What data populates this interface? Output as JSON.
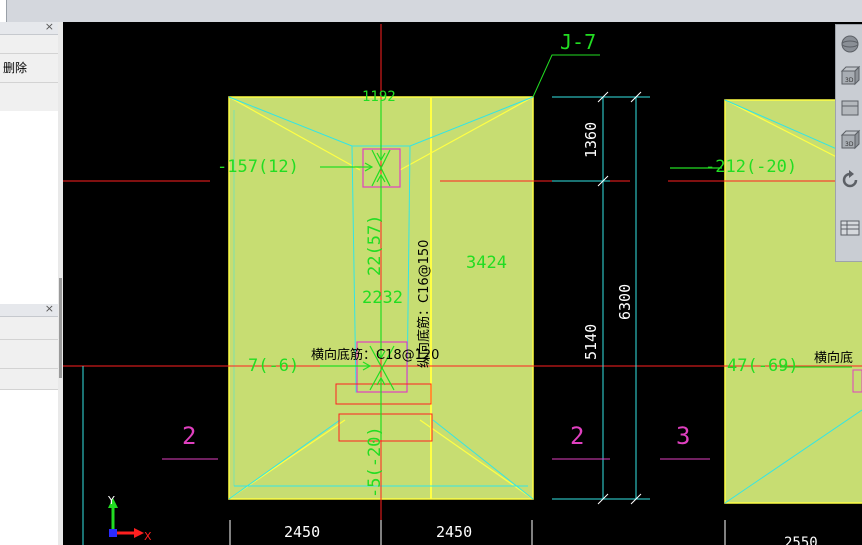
{
  "left_panel_top": {
    "delete_label": "删除"
  },
  "drawing": {
    "foundation_label": "J-7",
    "top_mark": "1192",
    "rebar_x": "横向底筋：C18@120",
    "rebar_y": "纵向底筋：C16@150",
    "val_top_left": "-157(12)",
    "val_mid_left": "7(-6)",
    "val_vertical_1": "22(57)",
    "val_vertical_2": "2232",
    "val_right": "3424",
    "val_bottom": "-5(-20)",
    "dim_1360": "1360",
    "dim_5140": "5140",
    "dim_6300": "6300",
    "dim_2450_left": "2450",
    "dim_2450_right": "2450",
    "axis_2_left": "2",
    "axis_2_right": "2",
    "axis_3": "3",
    "val_right_top": "-212(-20)",
    "val_right_mid": "47(-69)",
    "rebar_right_partial": "横向底",
    "dim_right_partial": "2550",
    "ucs_y": "Y",
    "ucs_x": "X"
  },
  "viewtools": {
    "cube_label_1": "3D",
    "cube_label_2": "3D"
  },
  "colors": {
    "footing_fill": "#c7dd72",
    "grid_red": "#ff2020",
    "cyan": "#33e5e5",
    "green_text": "#22dd22",
    "magenta": "#e040c0",
    "yellow": "#ffff33"
  }
}
